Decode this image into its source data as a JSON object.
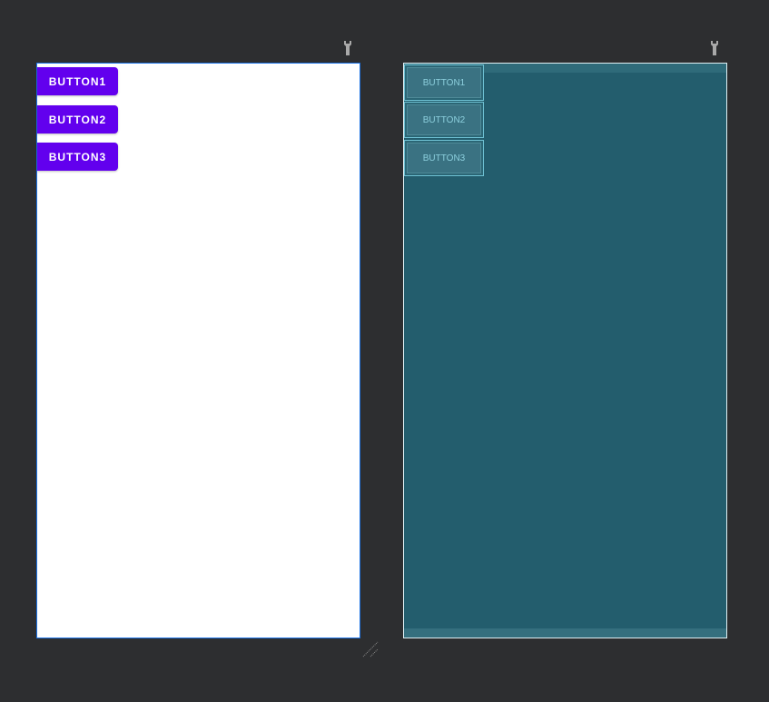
{
  "design_view": {
    "buttons": [
      "BUTTON1",
      "BUTTON2",
      "BUTTON3"
    ]
  },
  "blueprint_view": {
    "buttons": [
      "BUTTON1",
      "BUTTON2",
      "BUTTON3"
    ]
  },
  "colors": {
    "accent": "#6200ee",
    "blueprint": "#235d6d",
    "background": "#2d2e30"
  }
}
